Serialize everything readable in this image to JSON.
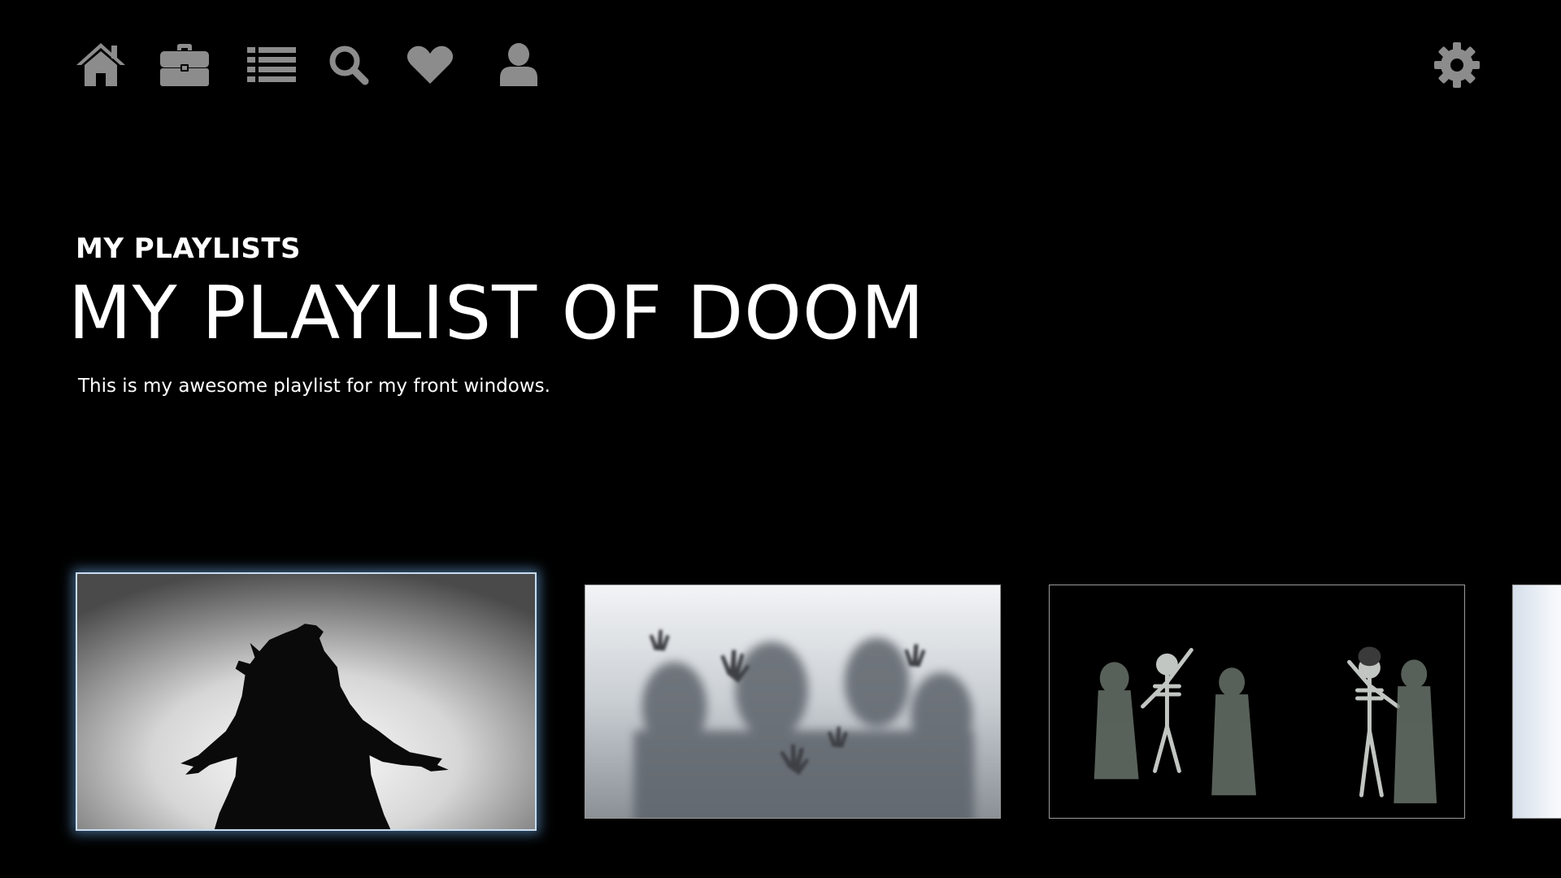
{
  "nav": {
    "items": [
      {
        "icon": "home-icon"
      },
      {
        "icon": "briefcase-icon"
      },
      {
        "icon": "list-icon"
      },
      {
        "icon": "search-icon"
      },
      {
        "icon": "heart-icon"
      },
      {
        "icon": "user-icon"
      }
    ],
    "settings_icon": "gear-icon",
    "icon_color": "#8c8c8c"
  },
  "header": {
    "section_label": "MY PLAYLISTS",
    "title": "MY PLAYLIST OF DOOM",
    "description": "This is my awesome playlist for my front windows."
  },
  "playlist": {
    "thumbnails": [
      {
        "subject": "werewolf-silhouette",
        "selected": true
      },
      {
        "subject": "zombie-hands-behind-glass",
        "selected": false
      },
      {
        "subject": "dancing-skeletons",
        "selected": false
      },
      {
        "subject": "partial-next-item",
        "selected": false
      }
    ]
  },
  "colors": {
    "background": "#000000",
    "text": "#ffffff",
    "icon": "#8c8c8c",
    "focus_glow": "#6eaae6"
  }
}
